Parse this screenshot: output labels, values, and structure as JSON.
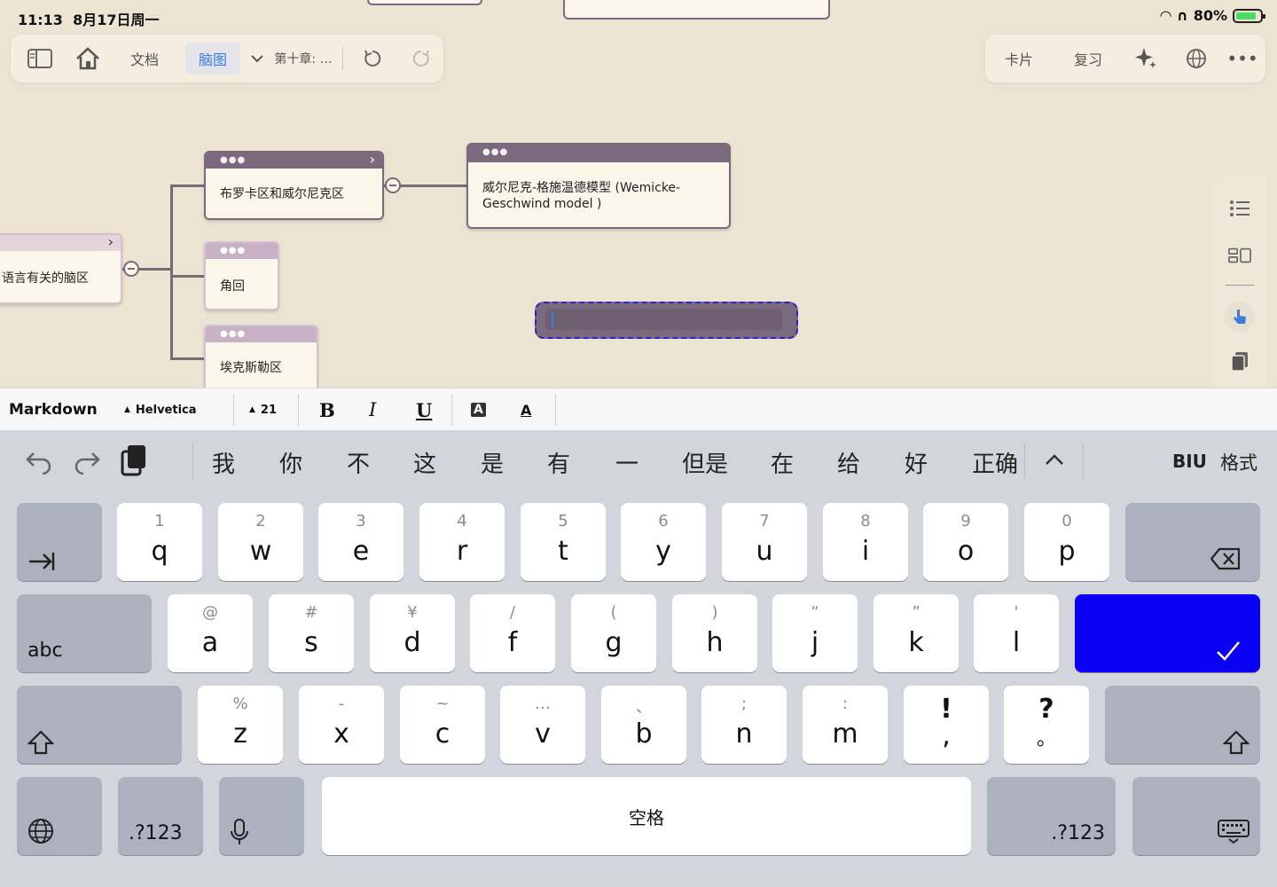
{
  "status": {
    "time": "11:13",
    "date": "8月17日周一",
    "battery": "80%"
  },
  "toolbar_left": {
    "doc_tab": "文档",
    "mindmap_tab": "脑图",
    "chapter": "第十章: …"
  },
  "toolbar_right": {
    "cards": "卡片",
    "review": "复习"
  },
  "mindmap": {
    "root_label": "语言有关的脑区",
    "node_broca": "布罗卡区和威尔尼克区",
    "node_angular": "角回",
    "node_exner": "埃克斯勒区",
    "node_wernicke_line1": "威尔尼克-格施温德模型 (Wemicke-",
    "node_wernicke_line2": "Geschwind model )"
  },
  "format_bar": {
    "mode": "Markdown",
    "font": "Helvetica",
    "size": "21",
    "bold": "B",
    "italic": "I",
    "underline": "U",
    "highlight": "A",
    "text_color": "A"
  },
  "candidates": [
    "我",
    "你",
    "不",
    "这",
    "是",
    "有",
    "一",
    "但是",
    "在",
    "给",
    "好",
    "正确"
  ],
  "candidate_format": {
    "biu": "BIU",
    "format": "格式"
  },
  "keyboard": {
    "row1": [
      {
        "sub": "1",
        "key": "q"
      },
      {
        "sub": "2",
        "key": "w"
      },
      {
        "sub": "3",
        "key": "e"
      },
      {
        "sub": "4",
        "key": "r"
      },
      {
        "sub": "5",
        "key": "t"
      },
      {
        "sub": "6",
        "key": "y"
      },
      {
        "sub": "7",
        "key": "u"
      },
      {
        "sub": "8",
        "key": "i"
      },
      {
        "sub": "9",
        "key": "o"
      },
      {
        "sub": "0",
        "key": "p"
      }
    ],
    "row2": [
      {
        "sub": "@",
        "key": "a"
      },
      {
        "sub": "#",
        "key": "s"
      },
      {
        "sub": "¥",
        "key": "d"
      },
      {
        "sub": "/",
        "key": "f"
      },
      {
        "sub": "(",
        "key": "g"
      },
      {
        "sub": ")",
        "key": "h"
      },
      {
        "sub": "“",
        "key": "j"
      },
      {
        "sub": "”",
        "key": "k"
      },
      {
        "sub": "'",
        "key": "l"
      }
    ],
    "row3": [
      {
        "sub": "%",
        "key": "z"
      },
      {
        "sub": "-",
        "key": "x"
      },
      {
        "sub": "~",
        "key": "c"
      },
      {
        "sub": "…",
        "key": "v"
      },
      {
        "sub": "、",
        "key": "b"
      },
      {
        "sub": ";",
        "key": "n"
      },
      {
        "sub": ":",
        "key": "m"
      },
      {
        "sub": "!",
        "key": ","
      },
      {
        "sub": "?",
        "key": "。"
      }
    ],
    "abc_label": "abc",
    "num_label": ".?123",
    "space_label": "空格"
  },
  "colors": {
    "accent_blue": "#0a00f5",
    "node_header": "#7b6a7d",
    "background": "#ebe4d2"
  }
}
